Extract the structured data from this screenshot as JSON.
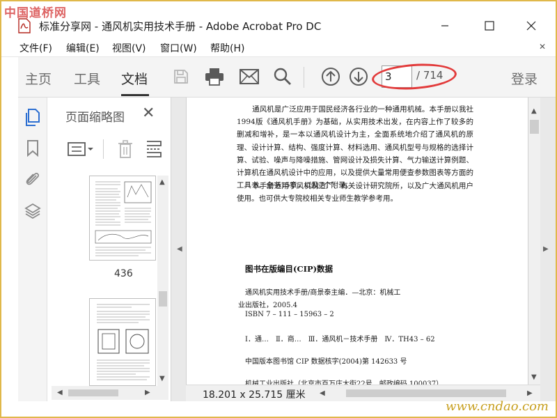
{
  "watermark": {
    "top": "中国道桥网",
    "bottom": "www.cndao.com"
  },
  "window": {
    "title": "标准分享网 - 通风机实用技术手册 - Adobe Acrobat Pro DC",
    "minimize": "—",
    "maximize": "☐",
    "close": "✕"
  },
  "menu": {
    "items": [
      "文件(F)",
      "编辑(E)",
      "视图(V)",
      "窗口(W)",
      "帮助(H)"
    ],
    "close": "✕"
  },
  "toolbar": {
    "tabs": [
      "主页",
      "工具",
      "文档"
    ],
    "active_tab": "文档",
    "icons": [
      "save-icon",
      "print-icon",
      "email-icon",
      "search-icon",
      "prev-page-icon",
      "next-page-icon"
    ],
    "current_page": "3",
    "total_pages": "/ 714",
    "login": "登录"
  },
  "nav": {
    "icons": [
      "page-thumbnails-icon",
      "bookmark-icon",
      "attachment-icon",
      "layers-icon"
    ],
    "active": "page-thumbnails-icon"
  },
  "thumbnail_panel": {
    "title": "页面缩略图",
    "close": "✕",
    "tools": [
      "options-menu-icon",
      "delete-icon",
      "extract-icon"
    ],
    "thumbnails": [
      {
        "label": "436"
      }
    ]
  },
  "document": {
    "paragraph1": "通风机是广泛应用于国民经济各行业的一种通用机械。本手册以我社1994版《通风机手册》为基础，从实用技术出发，在内容上作了较多的删减和增补，是一本以通风机设计为主，全面系统地介绍了通风机的原理、设计计算、结构、强度计算、材料选用、通风机型号与规格的选择计算、试验、噪声与降噪措施、管网设计及损失计算、气力输送计算例题、计算机在通风机设计中的应用，以及提供大量常用便查参数图表等方面的工具书。全书15章，以及7个附录。",
    "paragraph2": "本手册适用于风机制造厂、有关设计研究院所，以及广大通风机用户使用。也可供大专院校相关专业师生教学参考用。",
    "cip_title": "图书在版编目(CIP)数据",
    "cip_line1": "通风机实用技术手册/商景泰主编．—北京：机械工",
    "cip_line2": "业出版社，2005.4",
    "cip_line3": "ISBN 7 – 111 – 15963 – 2",
    "cip_line4": "Ⅰ．通…　Ⅱ．商…　Ⅲ．通风机－技术手册　Ⅳ．TH43 – 62",
    "cip_line5": "中国版本图书馆 CIP 数据核字(2004)第 142633 号",
    "cip_line6": "机械工业出版社（北京市百万庄大街22号　邮政编码 100037）"
  },
  "status": {
    "page_size": "18.201 x 25.715 厘米"
  },
  "colors": {
    "annotation_oval": "#e23a3a",
    "icon_gray": "#5a5a5a",
    "nav_active_blue": "#2d6fd1"
  }
}
